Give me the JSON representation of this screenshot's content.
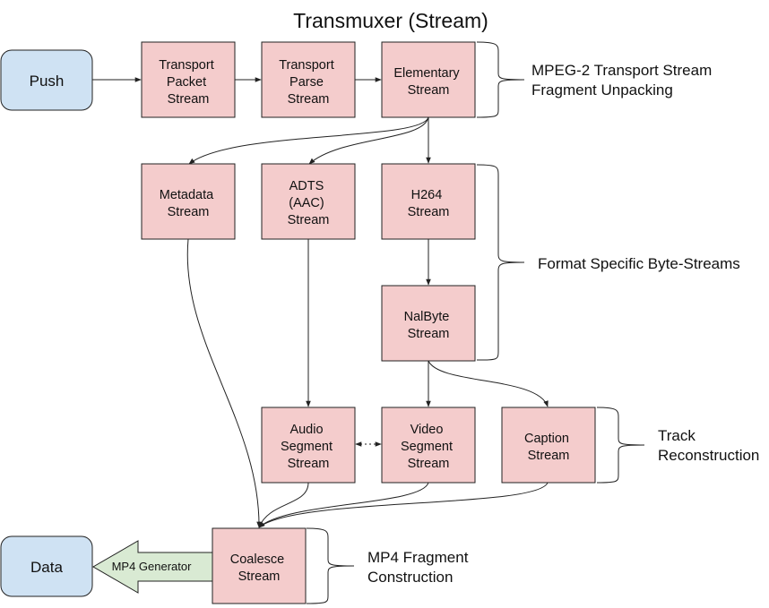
{
  "title": "Transmuxer (Stream)",
  "colors": {
    "stream_fill": "#f4cccc",
    "terminal_fill": "#cfe2f3",
    "generator_fill": "#d9ead3",
    "stroke": "#222222"
  },
  "terminals": {
    "push": "Push",
    "data": "Data"
  },
  "streams": {
    "transport_packet": [
      "Transport",
      "Packet",
      "Stream"
    ],
    "transport_parse": [
      "Transport",
      "Parse",
      "Stream"
    ],
    "elementary": [
      "Elementary",
      "Stream"
    ],
    "metadata": [
      "Metadata",
      "Stream"
    ],
    "adts": [
      "ADTS",
      "(AAC)",
      "Stream"
    ],
    "h264": [
      "H264",
      "Stream"
    ],
    "nalbyte": [
      "NalByte",
      "Stream"
    ],
    "audio_segment": [
      "Audio",
      "Segment",
      "Stream"
    ],
    "video_segment": [
      "Video",
      "Segment",
      "Stream"
    ],
    "caption": [
      "Caption",
      "Stream"
    ],
    "coalesce": [
      "Coalesce",
      "Stream"
    ]
  },
  "generator": "MP4 Generator",
  "groups": {
    "unpacking": [
      "MPEG-2 Transport Stream",
      "Fragment Unpacking"
    ],
    "byte_streams": [
      "Format Specific Byte-Streams"
    ],
    "track": [
      "Track",
      "Reconstruction"
    ],
    "fragment": [
      "MP4 Fragment",
      "Construction"
    ]
  },
  "edges": [
    {
      "from": "push",
      "to": "transport_packet",
      "style": "solid"
    },
    {
      "from": "transport_packet",
      "to": "transport_parse",
      "style": "solid"
    },
    {
      "from": "transport_parse",
      "to": "elementary",
      "style": "solid"
    },
    {
      "from": "elementary",
      "to": "metadata",
      "style": "solid"
    },
    {
      "from": "elementary",
      "to": "adts",
      "style": "solid"
    },
    {
      "from": "elementary",
      "to": "h264",
      "style": "solid"
    },
    {
      "from": "h264",
      "to": "nalbyte",
      "style": "solid"
    },
    {
      "from": "nalbyte",
      "to": "video_segment",
      "style": "solid"
    },
    {
      "from": "nalbyte",
      "to": "caption",
      "style": "solid"
    },
    {
      "from": "adts",
      "to": "audio_segment",
      "style": "solid"
    },
    {
      "from": "audio_segment",
      "to": "video_segment",
      "style": "dotted-bidirectional"
    },
    {
      "from": "metadata",
      "to": "coalesce",
      "style": "solid"
    },
    {
      "from": "audio_segment",
      "to": "coalesce",
      "style": "solid"
    },
    {
      "from": "video_segment",
      "to": "coalesce",
      "style": "solid"
    },
    {
      "from": "caption",
      "to": "coalesce",
      "style": "solid"
    },
    {
      "from": "coalesce",
      "to": "data",
      "style": "block-arrow"
    }
  ]
}
